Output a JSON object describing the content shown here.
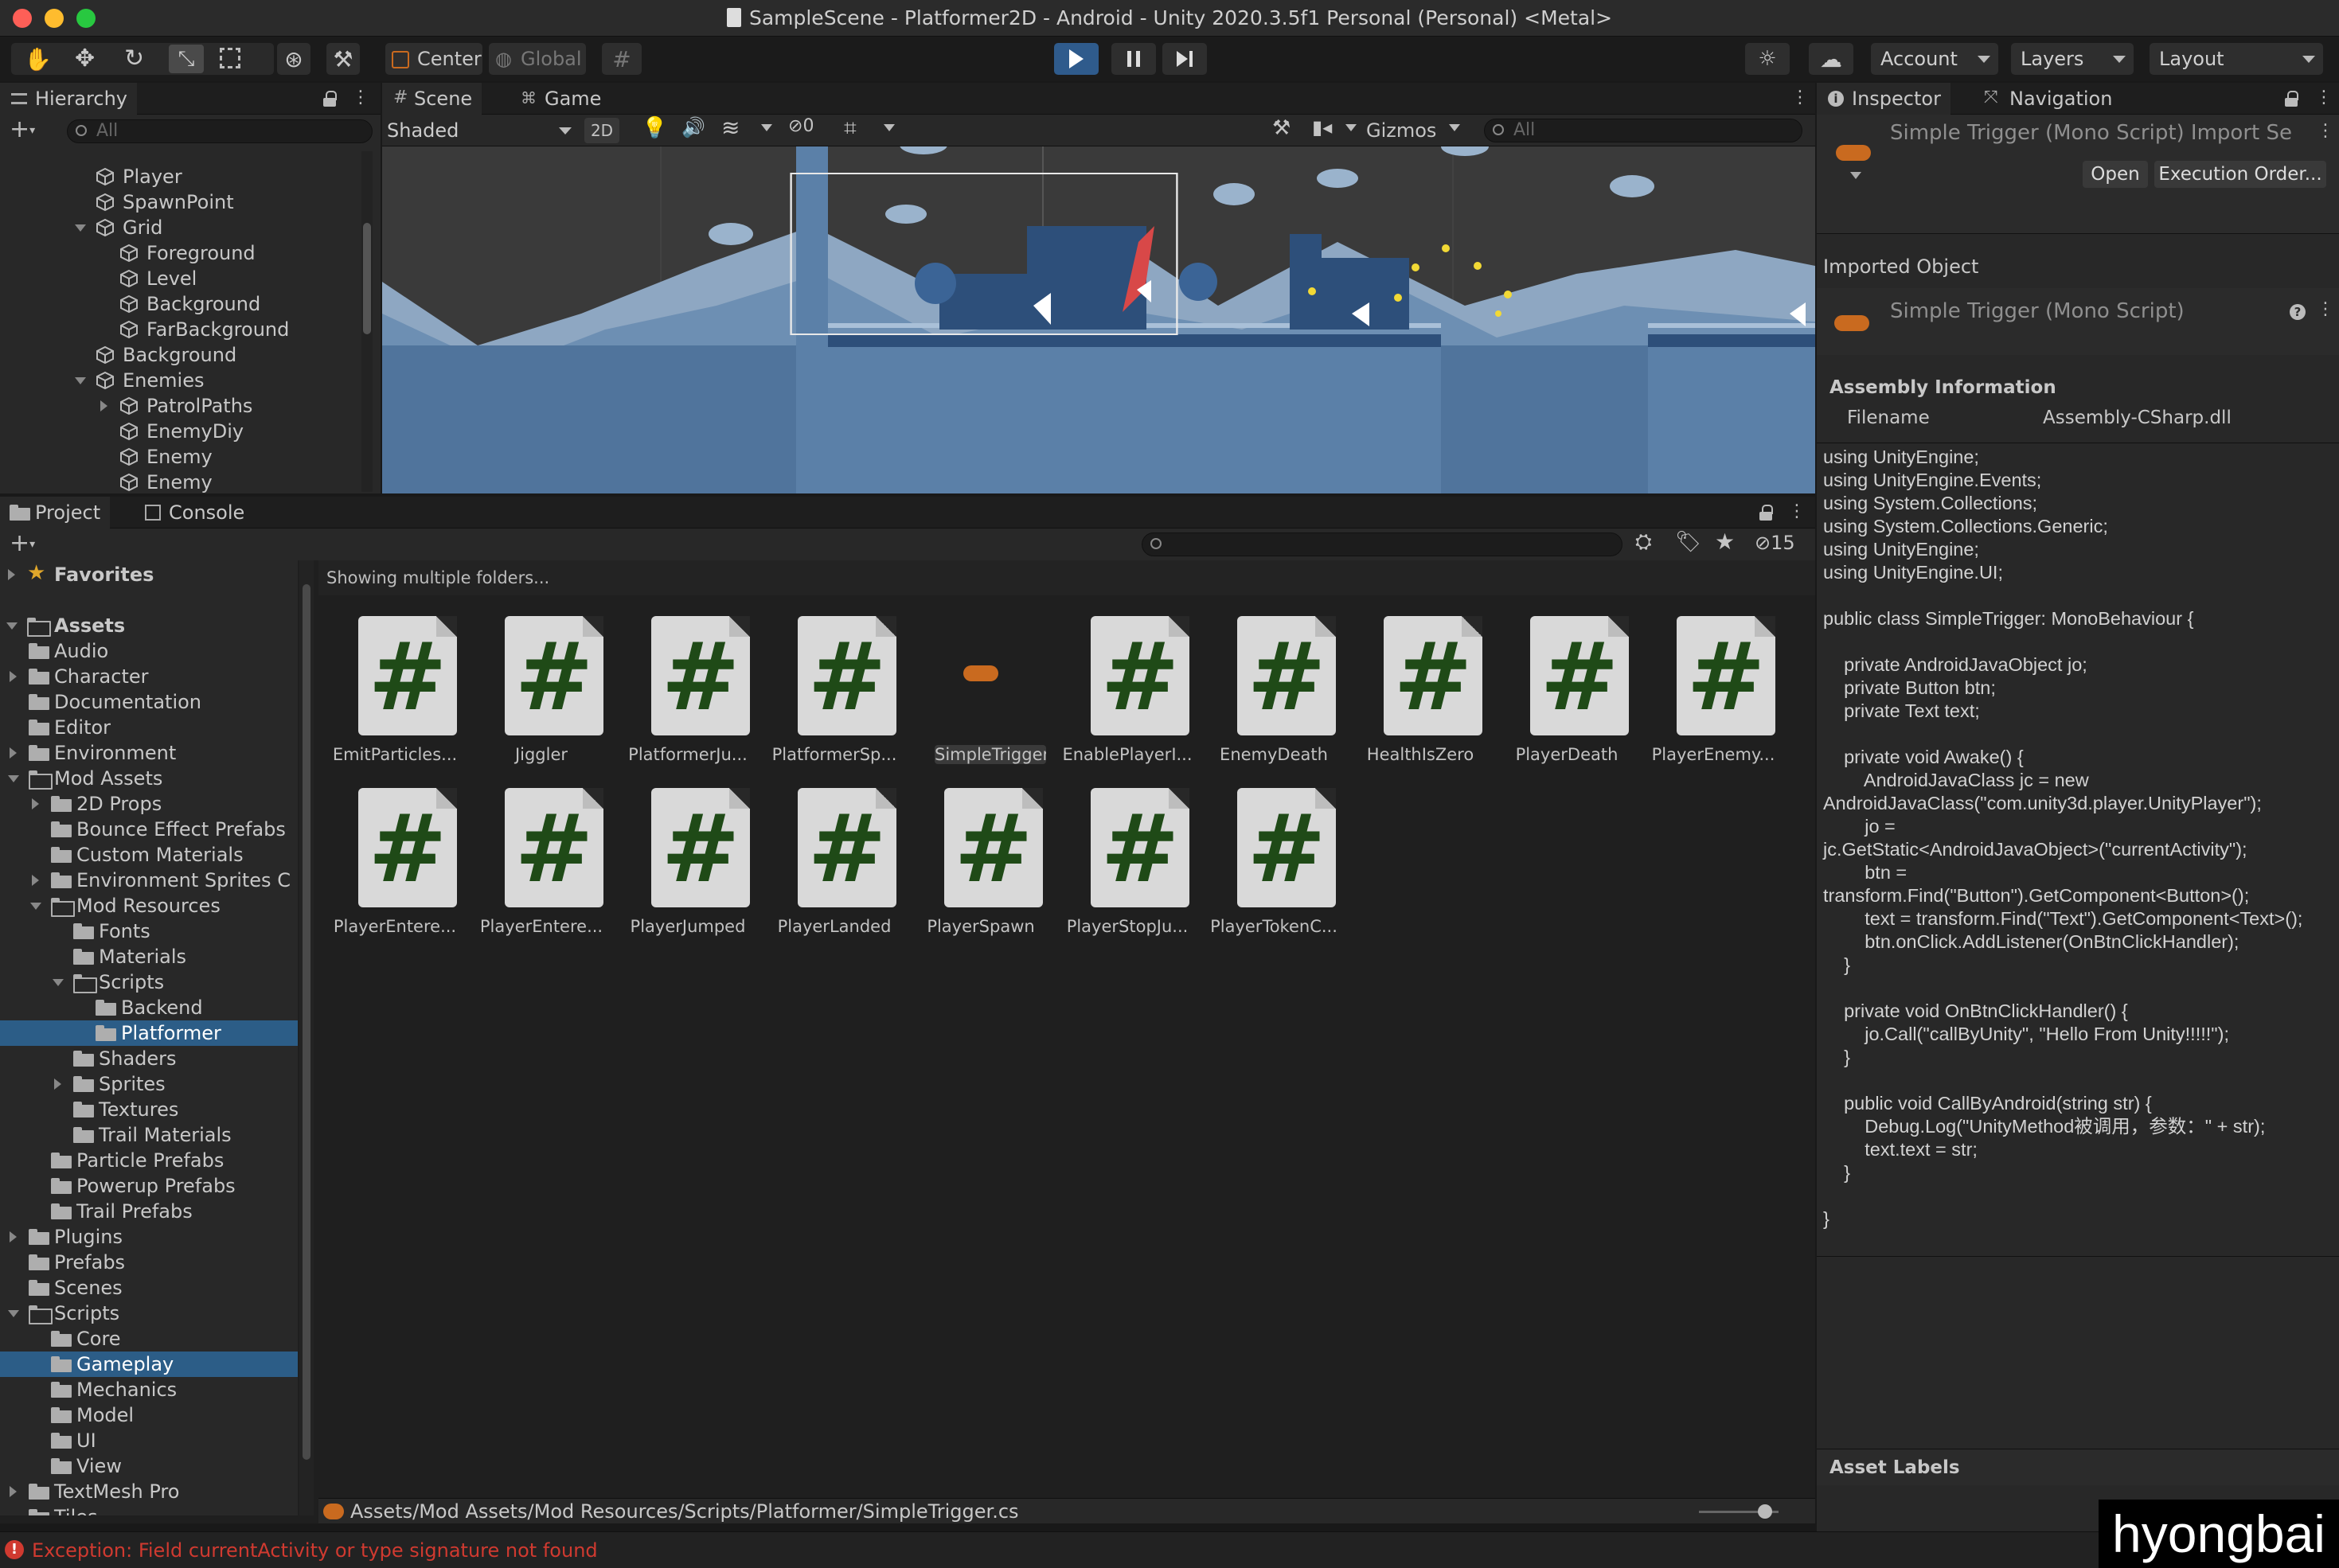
{
  "window": {
    "title": "SampleScene - Platformer2D - Android - Unity 2020.3.5f1 Personal (Personal) <Metal>"
  },
  "toolbar": {
    "pivot_label": "Center",
    "space_label": "Global",
    "account_label": "Account",
    "layers_label": "Layers",
    "layout_label": "Layout"
  },
  "hierarchy": {
    "tab_label": "Hierarchy",
    "search_placeholder": "All",
    "items": [
      {
        "label": "Player",
        "depth": 1
      },
      {
        "label": "SpawnPoint",
        "depth": 1
      },
      {
        "label": "Grid",
        "depth": 1,
        "expanded": true
      },
      {
        "label": "Foreground",
        "depth": 2
      },
      {
        "label": "Level",
        "depth": 2
      },
      {
        "label": "Background",
        "depth": 2
      },
      {
        "label": "FarBackground",
        "depth": 2
      },
      {
        "label": "Background",
        "depth": 1
      },
      {
        "label": "Enemies",
        "depth": 1,
        "expanded": true
      },
      {
        "label": "PatrolPaths",
        "depth": 2,
        "collapsed": true
      },
      {
        "label": "EnemyDiy",
        "depth": 2
      },
      {
        "label": "Enemy",
        "depth": 2
      },
      {
        "label": "Enemy",
        "depth": 2
      }
    ]
  },
  "scene": {
    "tab_scene": "Scene",
    "tab_game": "Game",
    "shading_mode": "Shaded",
    "mode_2d": "2D",
    "hidden_count": "0",
    "gizmos_label": "Gizmos",
    "search_placeholder": "All"
  },
  "project": {
    "tab_project": "Project",
    "tab_console": "Console",
    "hidden_count": "15",
    "status_text": "Showing multiple folders...",
    "favorites_label": "Favorites",
    "assets_label": "Assets",
    "tree": [
      {
        "label": "Audio",
        "depth": 1
      },
      {
        "label": "Character",
        "depth": 1,
        "collapsed": true
      },
      {
        "label": "Documentation",
        "depth": 1
      },
      {
        "label": "Editor",
        "depth": 1
      },
      {
        "label": "Environment",
        "depth": 1,
        "collapsed": true
      },
      {
        "label": "Mod Assets",
        "depth": 1,
        "expanded": true
      },
      {
        "label": "2D Props",
        "depth": 2,
        "collapsed": true
      },
      {
        "label": "Bounce Effect Prefabs",
        "depth": 2
      },
      {
        "label": "Custom Materials",
        "depth": 2
      },
      {
        "label": "Environment Sprites C",
        "depth": 2,
        "collapsed": true
      },
      {
        "label": "Mod Resources",
        "depth": 2,
        "expanded": true
      },
      {
        "label": "Fonts",
        "depth": 3
      },
      {
        "label": "Materials",
        "depth": 3
      },
      {
        "label": "Scripts",
        "depth": 3,
        "expanded": true
      },
      {
        "label": "Backend",
        "depth": 4
      },
      {
        "label": "Platformer",
        "depth": 4,
        "selected": true
      },
      {
        "label": "Shaders",
        "depth": 3
      },
      {
        "label": "Sprites",
        "depth": 3,
        "collapsed": true
      },
      {
        "label": "Textures",
        "depth": 3
      },
      {
        "label": "Trail Materials",
        "depth": 3
      },
      {
        "label": "Particle Prefabs",
        "depth": 2
      },
      {
        "label": "Powerup Prefabs",
        "depth": 2
      },
      {
        "label": "Trail Prefabs",
        "depth": 2
      },
      {
        "label": "Plugins",
        "depth": 1,
        "collapsed": true
      },
      {
        "label": "Prefabs",
        "depth": 1
      },
      {
        "label": "Scenes",
        "depth": 1
      },
      {
        "label": "Scripts",
        "depth": 1,
        "expanded": true
      },
      {
        "label": "Core",
        "depth": 2
      },
      {
        "label": "Gameplay",
        "depth": 2,
        "selected": true
      },
      {
        "label": "Mechanics",
        "depth": 2
      },
      {
        "label": "Model",
        "depth": 2
      },
      {
        "label": "UI",
        "depth": 2
      },
      {
        "label": "View",
        "depth": 2
      },
      {
        "label": "TextMesh Pro",
        "depth": 1,
        "collapsed": true
      },
      {
        "label": "Tiles",
        "depth": 1
      }
    ],
    "assets": [
      {
        "label": "EmitParticles...",
        "kind": "cs"
      },
      {
        "label": "Jiggler",
        "kind": "cs"
      },
      {
        "label": "PlatformerJu...",
        "kind": "cs"
      },
      {
        "label": "PlatformerSp...",
        "kind": "cs"
      },
      {
        "label": "SimpleTrigger",
        "kind": "pill",
        "selected": true
      },
      {
        "label": "EnablePlayerI...",
        "kind": "cs"
      },
      {
        "label": "EnemyDeath",
        "kind": "cs"
      },
      {
        "label": "HealthIsZero",
        "kind": "cs"
      },
      {
        "label": "PlayerDeath",
        "kind": "cs"
      },
      {
        "label": "PlayerEnemy...",
        "kind": "cs"
      },
      {
        "label": "PlayerEntere...",
        "kind": "cs"
      },
      {
        "label": "PlayerEntere...",
        "kind": "cs"
      },
      {
        "label": "PlayerJumped",
        "kind": "cs"
      },
      {
        "label": "PlayerLanded",
        "kind": "cs"
      },
      {
        "label": "PlayerSpawn",
        "kind": "cs"
      },
      {
        "label": "PlayerStopJu...",
        "kind": "cs"
      },
      {
        "label": "PlayerTokenC...",
        "kind": "cs"
      }
    ],
    "path_text": "Assets/Mod Assets/Mod Resources/Scripts/Platformer/SimpleTrigger.cs"
  },
  "inspector": {
    "tab_inspector": "Inspector",
    "tab_navigation": "Navigation",
    "header_title": "Simple Trigger (Mono Script) Import Se",
    "open_button": "Open",
    "execution_order_button": "Execution Order...",
    "imported_object_label": "Imported Object",
    "object_title": "Simple Trigger (Mono Script)",
    "assembly_section": "Assembly Information",
    "filename_label": "Filename",
    "filename_value": "Assembly-CSharp.dll",
    "code": "using UnityEngine;\nusing UnityEngine.Events;\nusing System.Collections;\nusing System.Collections.Generic;\nusing UnityEngine;\nusing UnityEngine.UI;\n\npublic class SimpleTrigger: MonoBehaviour {\n\n    private AndroidJavaObject jo;\n    private Button btn;\n    private Text text;\n\n    private void Awake() {\n        AndroidJavaClass jc = new\nAndroidJavaClass(\"com.unity3d.player.UnityPlayer\");\n        jo =\njc.GetStatic<AndroidJavaObject>(\"currentActivity\");\n        btn =\ntransform.Find(\"Button\").GetComponent<Button>();\n        text = transform.Find(\"Text\").GetComponent<Text>();\n        btn.onClick.AddListener(OnBtnClickHandler);\n    }\n\n    private void OnBtnClickHandler() {\n        jo.Call(\"callByUnity\", \"Hello From Unity!!!!!\");\n    }\n\n    public void CallByAndroid(string str) {\n        Debug.Log(\"UnityMethod被调用，参数：\" + str);\n        text.text = str;\n    }\n\n}",
    "asset_labels": "Asset Labels"
  },
  "statusbar": {
    "error_text": "Exception: Field currentActivity or type signature  not found"
  },
  "watermark": "hyongbai",
  "colors": {
    "selection": "#2c5d87",
    "play_active": "#2f5b8c",
    "error": "#d03a30",
    "script_pill": "#c96a1f",
    "hash": "#1f4a17"
  }
}
